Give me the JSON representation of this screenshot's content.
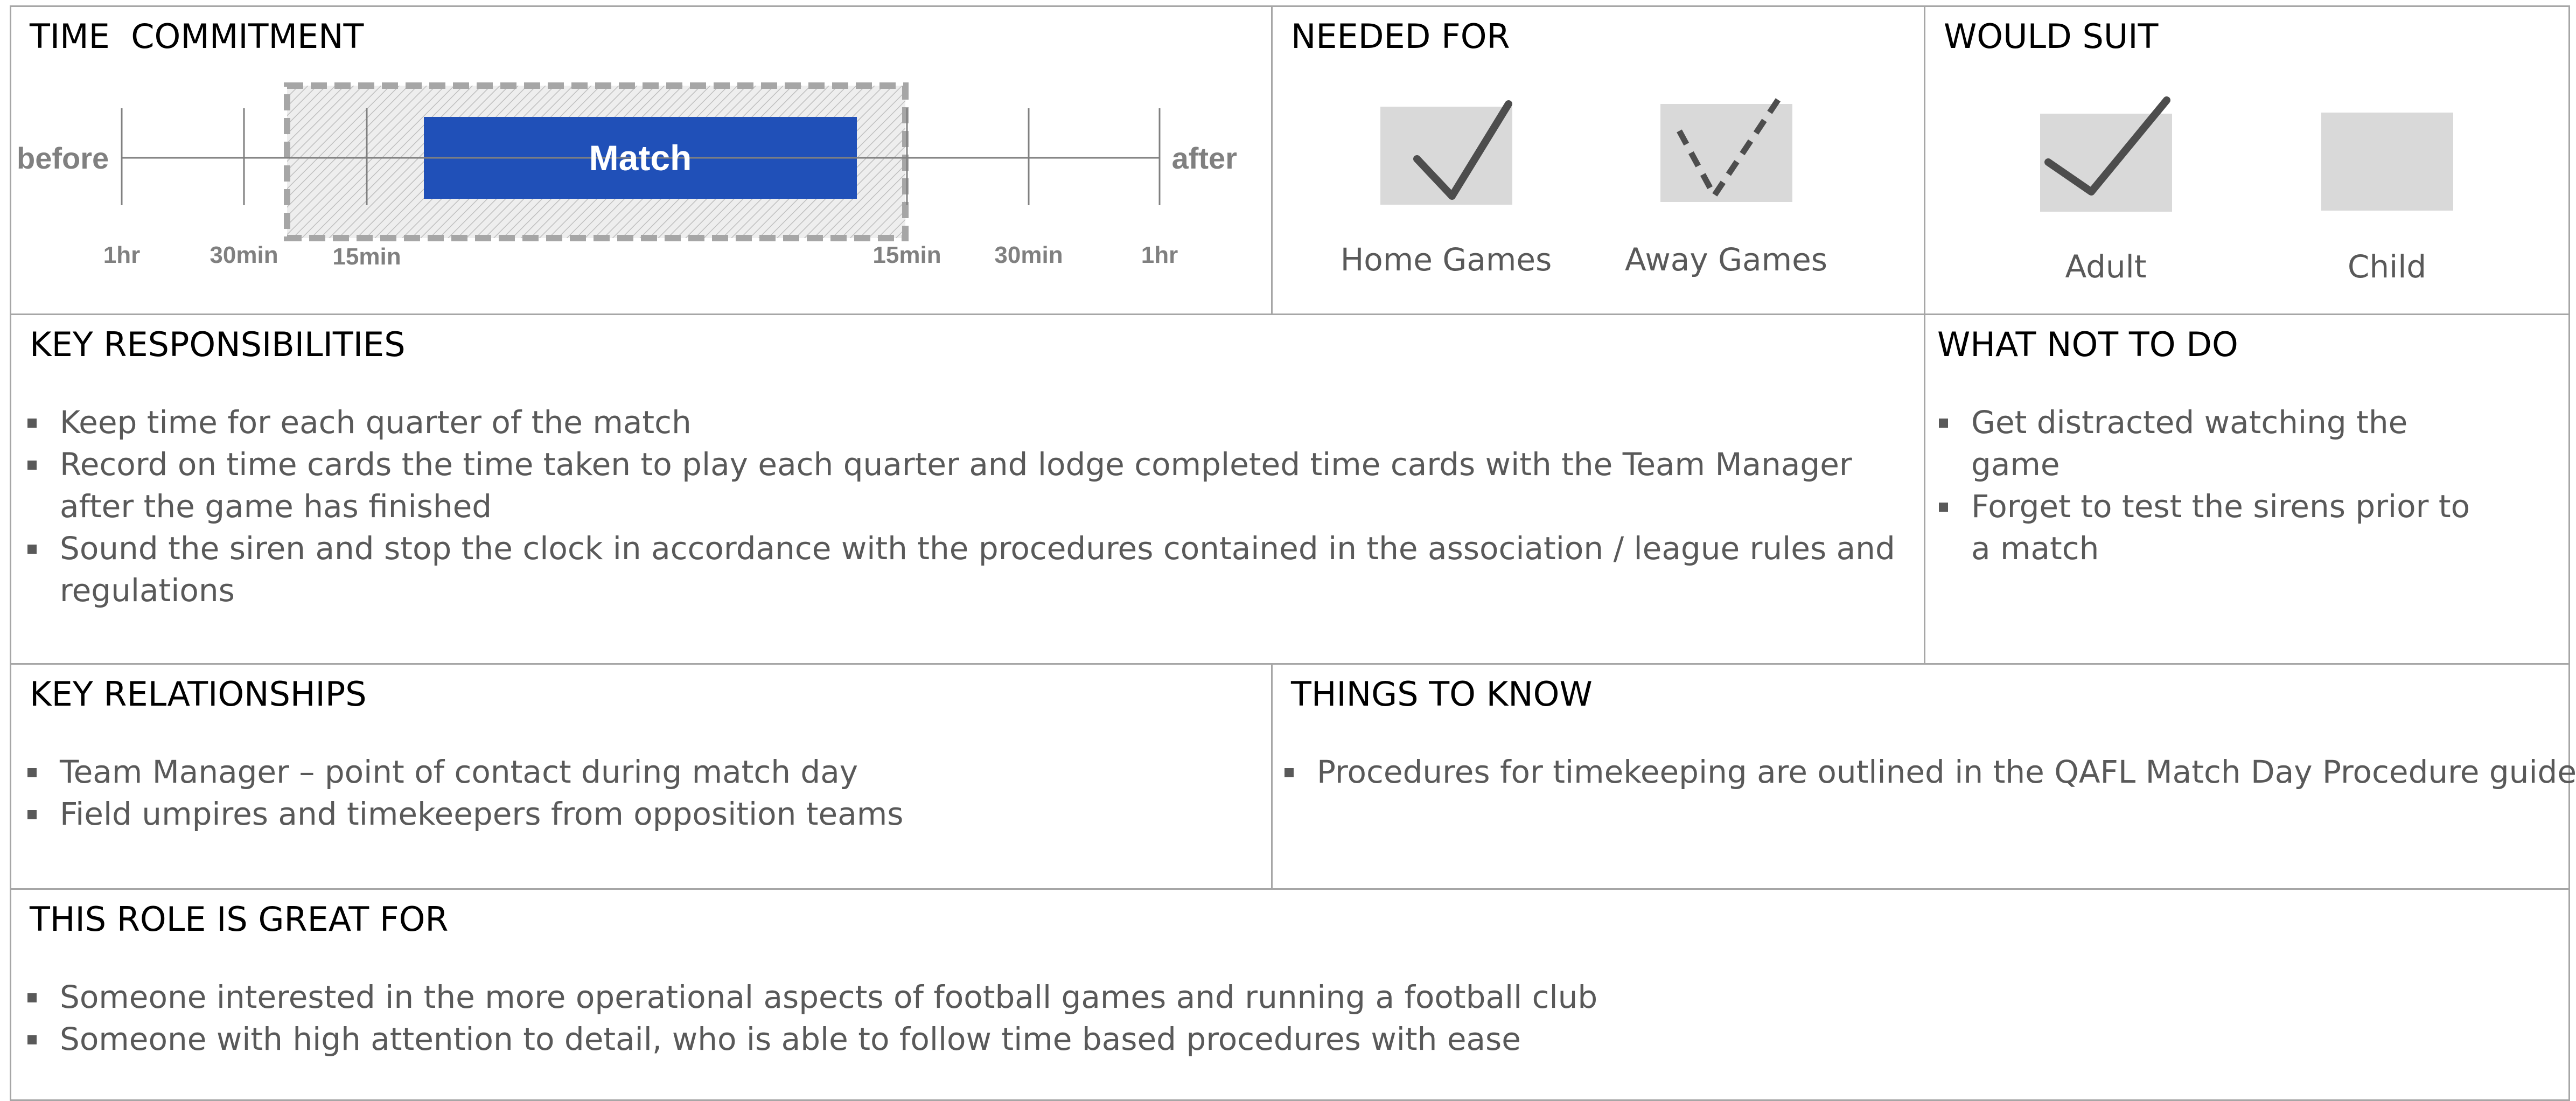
{
  "time_commitment": {
    "title": "TIME  COMMITMENT",
    "before_label": "before",
    "after_label": "after",
    "match_label": "Match",
    "ticks_before": [
      "1hr",
      "30min",
      "15min"
    ],
    "ticks_after": [
      "15min",
      "30min",
      "1hr"
    ],
    "match_color": "#2050b8",
    "window_before": "15min",
    "window_after": "15min"
  },
  "needed_for": {
    "title": "NEEDED FOR",
    "options": [
      {
        "label": "Home Games",
        "state": "checked"
      },
      {
        "label": "Away Games",
        "state": "partial"
      }
    ]
  },
  "would_suit": {
    "title": "WOULD SUIT",
    "options": [
      {
        "label": "Adult",
        "state": "checked"
      },
      {
        "label": "Child",
        "state": "unchecked"
      }
    ]
  },
  "key_responsibilities": {
    "title": "KEY RESPONSIBILITIES",
    "items": [
      "Keep time for each quarter of the match",
      "Record on time cards the time taken to play each quarter and lodge completed time cards with the Team Manager after the game has finished",
      "Sound the siren and stop the clock in accordance with the procedures contained in the association / league rules and regulations"
    ]
  },
  "what_not_to_do": {
    "title": "WHAT NOT TO DO",
    "items": [
      "Get distracted watching the game",
      "Forget to test the sirens prior to a match"
    ]
  },
  "key_relationships": {
    "title": "KEY RELATIONSHIPS",
    "items": [
      "Team Manager – point of contact during match day",
      "Field umpires and timekeepers from opposition teams"
    ]
  },
  "things_to_know": {
    "title": "THINGS TO KNOW",
    "items": [
      "Procedures for timekeeping are outlined in the QAFL Match Day Procedure guide"
    ]
  },
  "great_for": {
    "title": "THIS ROLE IS GREAT FOR",
    "items": [
      "Someone interested in the more operational aspects of football games and running a football club",
      "Someone with high attention to detail, who is able to follow time based procedures with ease"
    ]
  },
  "icons": {
    "checkbox_checked": "check-icon",
    "checkbox_partial": "dashed-check-icon",
    "bullet": "square-bullet-icon"
  }
}
